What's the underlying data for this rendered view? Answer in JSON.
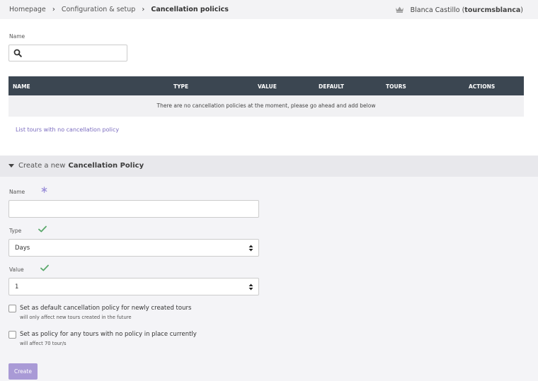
{
  "breadcrumb": {
    "items": [
      "Homepage",
      "Configuration & setup"
    ],
    "current": "Cancellation policics"
  },
  "user": {
    "name": "Blanca Castillo",
    "username": "tourcmsblanca"
  },
  "search": {
    "label": "Name",
    "value": "",
    "placeholder": ""
  },
  "table": {
    "columns": [
      "NAME",
      "TYPE",
      "VALUE",
      "DEFAULT",
      "TOURS",
      "ACTIONS"
    ],
    "empty_message": "There are no cancellation policies at the moment, please go ahead and add below"
  },
  "list_link": "List tours with no cancellation policy",
  "create": {
    "prefix": "Create a new",
    "title": "Cancellation Policy",
    "name_label": "Name",
    "name_value": "",
    "type_label": "Type",
    "type_value": "Days",
    "value_label": "Value",
    "value_value": "1",
    "default_check_label": "Set as default cancellation policy for newly created tours",
    "default_check_sub": "will only affect new tours created in the future",
    "policy_check_label": "Set as policy for any tours with no policy in place currently",
    "policy_check_sub": "will affect 70 tour/s",
    "button_label": "Create"
  },
  "colors": {
    "table_header": "#3b4651",
    "link": "#7a6bbf",
    "required_mark": "#9b8fd9",
    "valid_mark": "#5aa86b",
    "button": "#a99ad6"
  },
  "icons": {
    "crown": "crown-icon",
    "search": "search-icon",
    "caret": "caret-down-icon",
    "required": "asterisk-icon",
    "valid": "check-icon",
    "select": "sort-arrows-icon"
  }
}
